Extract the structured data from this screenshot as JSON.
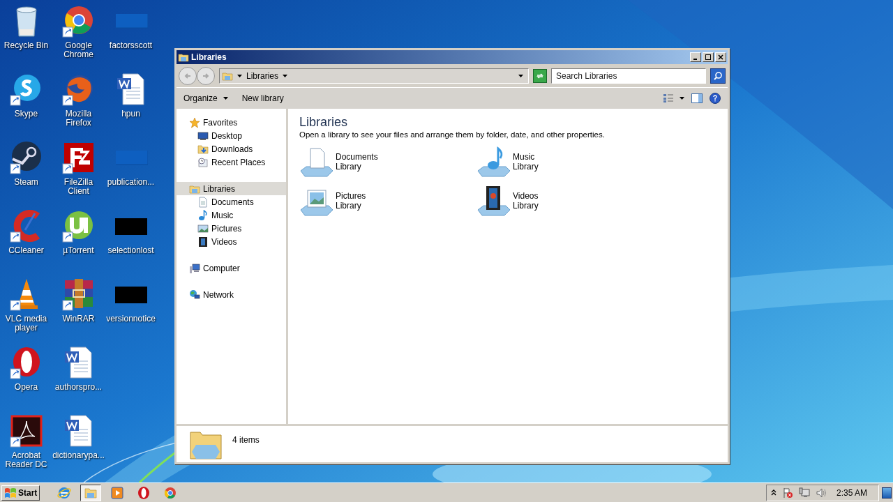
{
  "desktop": {
    "icons": [
      {
        "label": "Recycle Bin",
        "kind": "bin",
        "shortcut": false
      },
      {
        "label": "Skype",
        "kind": "skype",
        "shortcut": true
      },
      {
        "label": "Steam",
        "kind": "steam",
        "shortcut": true
      },
      {
        "label": "CCleaner",
        "kind": "ccleaner",
        "shortcut": true
      },
      {
        "label": "VLC media player",
        "kind": "vlc",
        "shortcut": true
      },
      {
        "label": "Opera",
        "kind": "opera",
        "shortcut": true
      },
      {
        "label": "Acrobat Reader DC",
        "kind": "acrobat",
        "shortcut": true
      },
      {
        "label": "Google Chrome",
        "kind": "chrome",
        "shortcut": true
      },
      {
        "label": "Mozilla Firefox",
        "kind": "firefox",
        "shortcut": true
      },
      {
        "label": "FileZilla Client",
        "kind": "filezilla",
        "shortcut": true
      },
      {
        "label": "µTorrent",
        "kind": "utorrent",
        "shortcut": true
      },
      {
        "label": "WinRAR",
        "kind": "winrar",
        "shortcut": true
      },
      {
        "label": "authorspro...",
        "kind": "word",
        "shortcut": false
      },
      {
        "label": "dictionarypa...",
        "kind": "word",
        "shortcut": false
      },
      {
        "label": "factorsscott",
        "kind": "blank",
        "shortcut": false
      },
      {
        "label": "hpun",
        "kind": "word",
        "shortcut": false
      },
      {
        "label": "publication...",
        "kind": "blank",
        "shortcut": false
      },
      {
        "label": "selectionlost",
        "kind": "black",
        "shortcut": false
      },
      {
        "label": "versionnotice",
        "kind": "black",
        "shortcut": false
      }
    ]
  },
  "window": {
    "title": "Libraries",
    "address": {
      "breadcrumb": "Libraries"
    },
    "search": {
      "placeholder": "Search Libraries"
    },
    "toolbar": [
      {
        "label": "Organize",
        "dropdown": true
      },
      {
        "label": "New library",
        "dropdown": false
      }
    ],
    "nav": [
      {
        "label": "Favorites",
        "kind": "star",
        "selected": false,
        "children": [
          {
            "label": "Desktop",
            "kind": "desktop",
            "selected": false
          },
          {
            "label": "Downloads",
            "kind": "downloads",
            "selected": false
          },
          {
            "label": "Recent Places",
            "kind": "recent",
            "selected": false
          }
        ]
      },
      {
        "label": "Libraries",
        "kind": "libraries",
        "selected": true,
        "children": [
          {
            "label": "Documents",
            "kind": "documents",
            "selected": false
          },
          {
            "label": "Music",
            "kind": "music",
            "selected": false
          },
          {
            "label": "Pictures",
            "kind": "pictures",
            "selected": false
          },
          {
            "label": "Videos",
            "kind": "videos",
            "selected": false
          }
        ]
      },
      {
        "label": "Computer",
        "kind": "computer",
        "selected": false
      },
      {
        "label": "Network",
        "kind": "network",
        "selected": false
      }
    ],
    "content": {
      "heading": "Libraries",
      "description": "Open a library to see your files and arrange them by folder, date, and other properties.",
      "libraries": [
        {
          "name": "Documents",
          "type": "Library",
          "kind": "documents"
        },
        {
          "name": "Music",
          "type": "Library",
          "kind": "music"
        },
        {
          "name": "Pictures",
          "type": "Library",
          "kind": "pictures"
        },
        {
          "name": "Videos",
          "type": "Library",
          "kind": "videos"
        }
      ]
    },
    "status": {
      "count": "4 items"
    }
  },
  "taskbar": {
    "start": "Start",
    "apps": [
      {
        "kind": "ie",
        "selected": false
      },
      {
        "kind": "explorer",
        "selected": true
      },
      {
        "kind": "media",
        "selected": false
      },
      {
        "kind": "opera",
        "selected": false
      },
      {
        "kind": "chrome",
        "selected": false
      }
    ],
    "clock": "2:35 AM"
  }
}
